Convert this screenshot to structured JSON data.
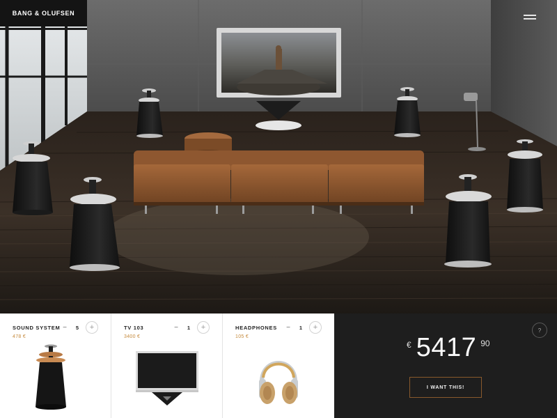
{
  "brand": {
    "name": "BANG & OLUFSEN"
  },
  "header": {
    "menu_icon": "hamburger-menu-icon"
  },
  "hero": {
    "description_icon": "living-room-scene"
  },
  "products": [
    {
      "name": "SOUND SYSTEM",
      "price": "478 €",
      "quantity": "5",
      "minus": "−",
      "plus": "+",
      "icon": "speaker-icon"
    },
    {
      "name": "TV 103",
      "price": "3400 €",
      "quantity": "1",
      "minus": "−",
      "plus": "+",
      "icon": "television-icon"
    },
    {
      "name": "HEADPHONES",
      "price": "105 €",
      "quantity": "1",
      "minus": "−",
      "plus": "+",
      "icon": "headphones-icon"
    }
  ],
  "checkout": {
    "info_badge": "?",
    "currency": "€",
    "amount": "5417",
    "cents": "90",
    "cta_label": "I WANT THIS!"
  },
  "colors": {
    "accent": "#c58a3d",
    "dark_panel": "#1e1e1e",
    "brand_bg": "#141414"
  }
}
